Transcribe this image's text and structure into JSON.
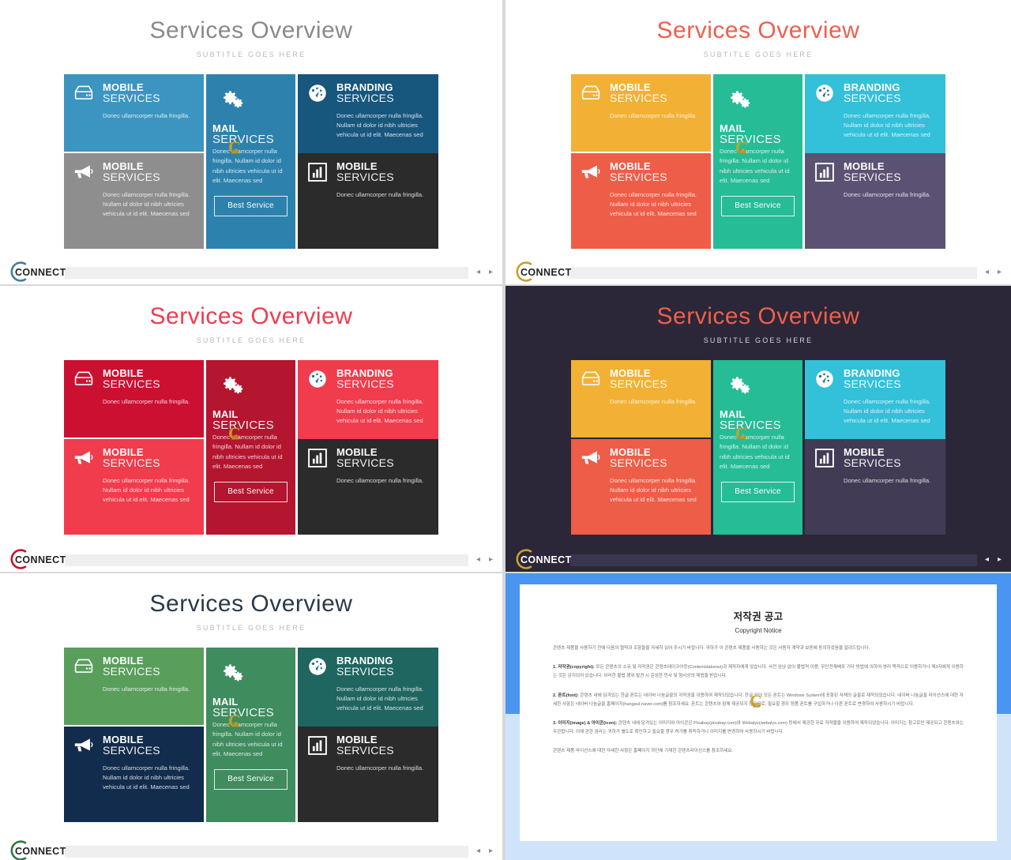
{
  "slide": {
    "title": "Services Overview",
    "subtitle": "SUBTITLE GOES HERE",
    "best_service_label": "Best Service",
    "logo_text": "CONNECT",
    "prev_arrow": "◂",
    "next_arrow": "▸"
  },
  "cards": {
    "a": {
      "icon": "server-icon",
      "line1": "MOBILE",
      "line2": "SERVICES",
      "body": "Donec ullamcorper nulla fringilla."
    },
    "b": {
      "icon": "megaphone-icon",
      "line1": "MOBILE",
      "line2": "SERVICES",
      "body": "Donec ullamcorper nulla fringilla. Nullam id dolor id nibh ultricies vehicula ut id elit. Maecenas sed"
    },
    "mail": {
      "icon": "gears-icon",
      "line1": "MAIL",
      "line2": "SERVICES",
      "body": "Donec ullamcorper nulla fringilla. Nullam id dolor id nibh ultricies vehicula ut id elit. Maecenas sed"
    },
    "c": {
      "icon": "gauge-icon",
      "line1": "BRANDING",
      "line2": "SERVICES",
      "body": "Donec ullamcorper nulla fringilla. Nullam id dolor id nibh ultricies vehicula ut id elit. Maecenas sed"
    },
    "d": {
      "icon": "bar-chart-icon",
      "line1": "MOBILE",
      "line2": "SERVICES",
      "body": "Donec ullamcorper nulla fringilla."
    }
  },
  "themes": [
    {
      "name": "blue",
      "background": "#ffffff",
      "title_color": "#8a8a8a",
      "logo_arc": "#3f7fa0",
      "a": "#3b95c0",
      "b": "#8e8e8e",
      "mail": "#2d82ad",
      "c": "#17567d",
      "d": "#2b2b2b"
    },
    {
      "name": "multicolor-light",
      "background": "#ffffff",
      "title_color": "#ef5f4c",
      "logo_arc": "#c8a02c",
      "a": "#f2b134",
      "b": "#ee5d47",
      "mail": "#26bc96",
      "c": "#33c0d9",
      "d": "#5b5273"
    },
    {
      "name": "red",
      "background": "#ffffff",
      "title_color": "#ef3b4e",
      "logo_arc": "#c8112b",
      "a": "#cc1032",
      "b": "#f03c4c",
      "mail": "#b4152f",
      "c": "#f03c4c",
      "d": "#2b2b2b"
    },
    {
      "name": "multicolor-dark",
      "background": "#2b2738",
      "title_color": "#ef5f4c",
      "logo_arc": "#c8a02c",
      "a": "#f2b134",
      "b": "#ee5d47",
      "mail": "#26bc96",
      "c": "#33c0d9",
      "d": "#413b56"
    },
    {
      "name": "green",
      "background": "#ffffff",
      "title_color": "#2b3a4a",
      "logo_arc": "#2f7a46",
      "a": "#5a9e5c",
      "b": "#112c4c",
      "mail": "#3f8c5f",
      "c": "#1f6560",
      "d": "#2b2b2b"
    }
  ],
  "copyright": {
    "title": "저작권 공고",
    "subtitle": "Copyright Notice",
    "p0": "콘텐츠 제품을 사용하기 전에 다음의 협약과 조항들을 자세히 읽어 주시기 바랍니다. 귀하가 이 콘텐츠 제품을 사용하는 것은 사용자 계약과 보증에 동의하셨음을 알려드립니다.",
    "p1_label": "1. 저작권(copyright):",
    "p1": " 모든 콘텐츠의 소유 및 저작권은 콘텐츠테이크아웃(Contentstakeout)과 제작자에게 있습니다. 사전 승낝 없이 불법적 이용, 무단전재배포 기타 방법에 의하여 영리 목적으로 이용하거나 제3자에게 이용하는 것은 금지되어 있습니다. 이러한 불법 행위 발견 시 준엄한 민사 및 형사상의 제법을 받습니다.",
    "p2_label": "2. 폰트(font):",
    "p2": " 콘텐츠 내에 담겨있는 한글 폰트는 네이버 나눔글꼴의 저작권을 이용하여 제작되었습니다. 한글 외의 모든 폰트는 Windows System에 포함된 자체의 글꼴로 제작되었습니다. 네이버 나눔글꼴 라이선스에 대한 자세한 사항은 네이버 나눔글꼴 홈페이지(hangeul.naver.com)를 참조하세요. 폰트는 콘텐츠와 함께 제공되지 않으므로, 필요할 경우 정품 폰트를 구입하거나 다른 폰트로 변경하여 사용하시기 바랍니다.",
    "p3_label": "3. 이미지(image) & 아이콘(icon):",
    "p3": " 콘텐츠 내에 담겨있는 이미지와 아이콘은 Pixabay(pixabay.com)와 Webalys(webalys.com) 등에서 제공한 무료 저작물을 이용하여 제작되었습니다. 이미지는 참고로만 제공되고 콘텐츠와는 무관합니다. 이에 관한 권리는 귀하가 별도로 확인하고 필요할 경우 허가를 취득하거나 이미지를 변경하여 사용하시기 바랍니다.",
    "p4": "콘텐츠 제품 라이선스에 대한 자세한 사항은 홈페이지 하단에 기재한 콘텐츠라이선스를 참조하세요."
  }
}
